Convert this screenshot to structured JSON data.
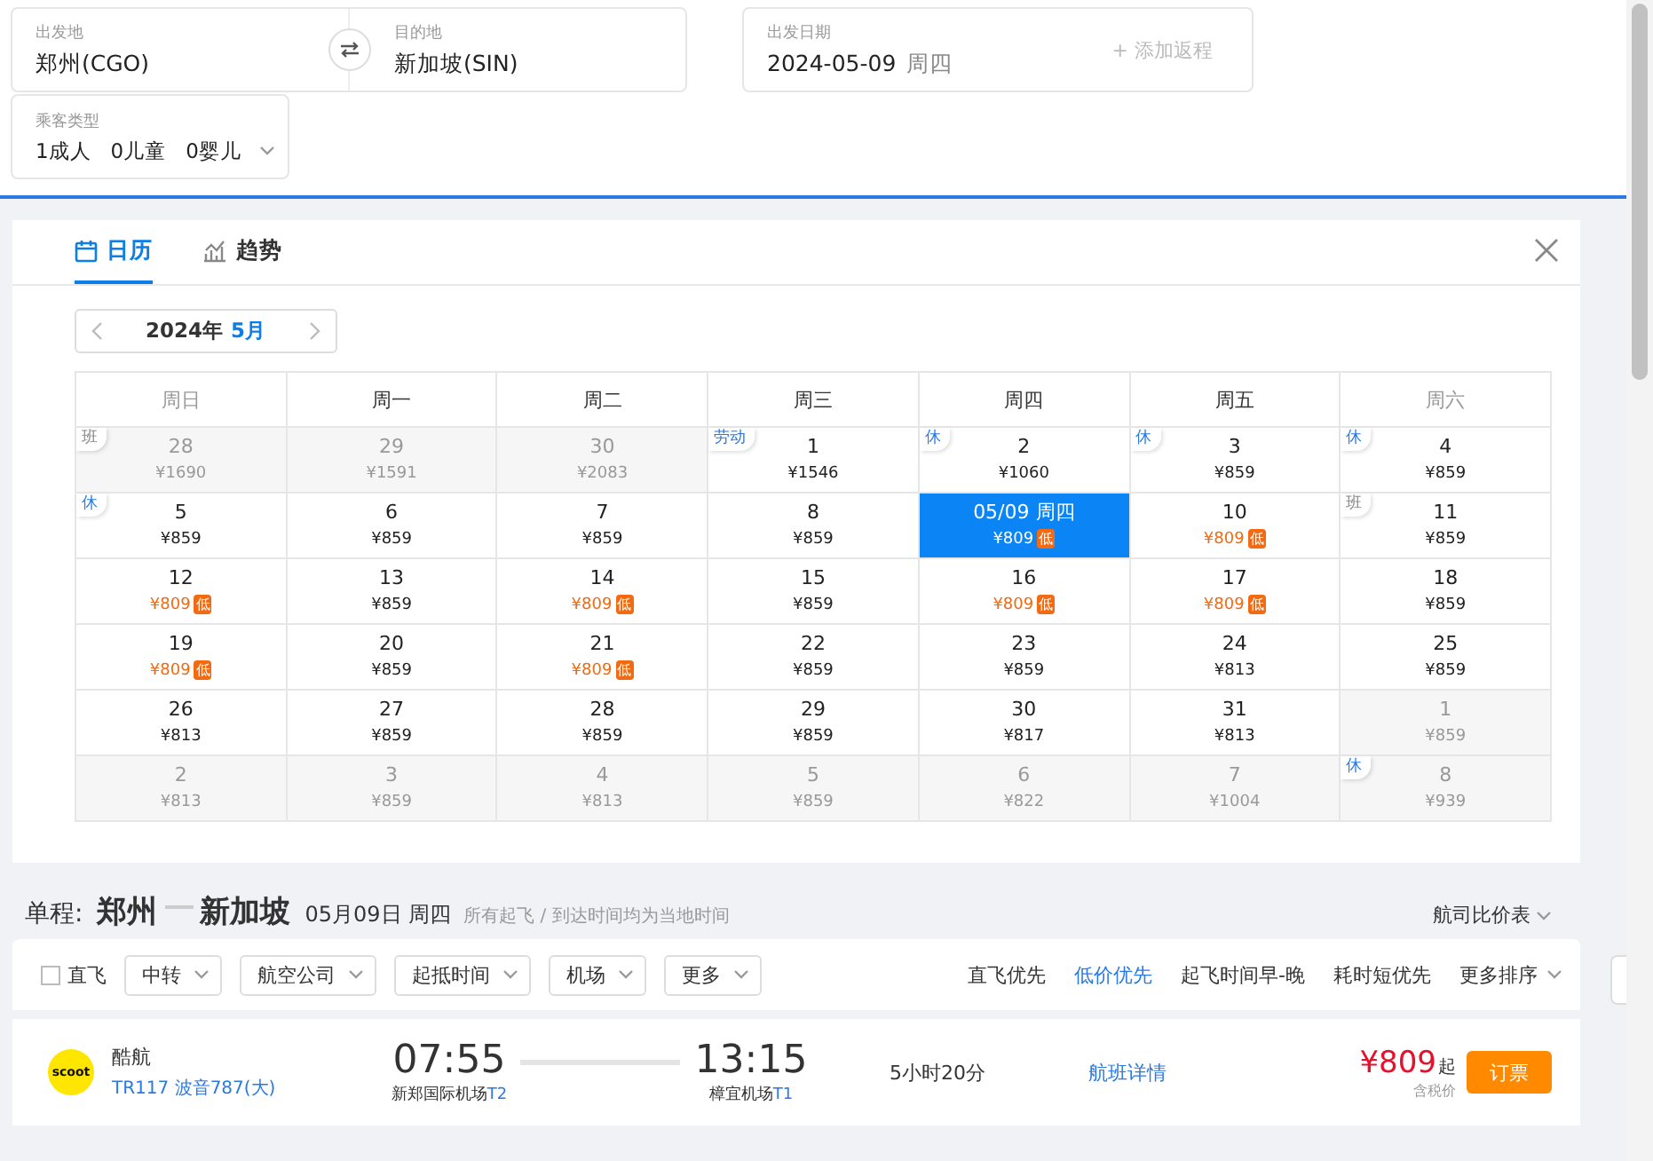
{
  "search": {
    "from": {
      "label": "出发地",
      "value": "郑州(CGO)"
    },
    "to": {
      "label": "目的地",
      "value": "新加坡(SIN)"
    },
    "date": {
      "label": "出发日期",
      "value": "2024-05-09",
      "weekday": "周四"
    },
    "add_return": "+ 添加返程",
    "passengers": {
      "label": "乘客类型",
      "value": "1成人   0儿童   0婴儿"
    }
  },
  "calendar": {
    "tabs": [
      {
        "label": "日历",
        "kind": "calendar",
        "selected": true
      },
      {
        "label": "趋势",
        "kind": "trend",
        "selected": false
      }
    ],
    "year": "2024年",
    "month": "5月",
    "weekdays": [
      {
        "label": "周日",
        "weekend": true
      },
      {
        "label": "周一",
        "weekend": false
      },
      {
        "label": "周二",
        "weekend": false
      },
      {
        "label": "周三",
        "weekend": false
      },
      {
        "label": "周四",
        "weekend": false
      },
      {
        "label": "周五",
        "weekend": false
      },
      {
        "label": "周六",
        "weekend": true
      }
    ],
    "weeks": [
      [
        {
          "day": "28",
          "price": "¥1690",
          "low": false,
          "muted": true,
          "selected": false,
          "tag": {
            "text": "班",
            "kind": "workday"
          }
        },
        {
          "day": "29",
          "price": "¥1591",
          "low": false,
          "muted": true,
          "selected": false
        },
        {
          "day": "30",
          "price": "¥2083",
          "low": false,
          "muted": true,
          "selected": false
        },
        {
          "day": "1",
          "price": "¥1546",
          "low": false,
          "muted": false,
          "selected": false,
          "tag": {
            "text": "劳动",
            "kind": "holiday"
          }
        },
        {
          "day": "2",
          "price": "¥1060",
          "low": false,
          "muted": false,
          "selected": false,
          "tag": {
            "text": "休",
            "kind": "holiday"
          }
        },
        {
          "day": "3",
          "price": "¥859",
          "low": false,
          "muted": false,
          "selected": false,
          "tag": {
            "text": "休",
            "kind": "holiday"
          }
        },
        {
          "day": "4",
          "price": "¥859",
          "low": false,
          "muted": false,
          "selected": false,
          "tag": {
            "text": "休",
            "kind": "holiday"
          }
        }
      ],
      [
        {
          "day": "5",
          "price": "¥859",
          "low": false,
          "muted": false,
          "selected": false,
          "tag": {
            "text": "休",
            "kind": "holiday"
          }
        },
        {
          "day": "6",
          "price": "¥859",
          "low": false,
          "muted": false,
          "selected": false
        },
        {
          "day": "7",
          "price": "¥859",
          "low": false,
          "muted": false,
          "selected": false
        },
        {
          "day": "8",
          "price": "¥859",
          "low": false,
          "muted": false,
          "selected": false
        },
        {
          "day": "05/09 周四",
          "price": "¥809",
          "low": true,
          "badge": "低",
          "muted": false,
          "selected": true
        },
        {
          "day": "10",
          "price": "¥809",
          "low": true,
          "badge": "低",
          "muted": false,
          "selected": false
        },
        {
          "day": "11",
          "price": "¥859",
          "low": false,
          "muted": false,
          "selected": false,
          "tag": {
            "text": "班",
            "kind": "workday"
          }
        }
      ],
      [
        {
          "day": "12",
          "price": "¥809",
          "low": true,
          "badge": "低",
          "muted": false,
          "selected": false
        },
        {
          "day": "13",
          "price": "¥859",
          "low": false,
          "muted": false,
          "selected": false
        },
        {
          "day": "14",
          "price": "¥809",
          "low": true,
          "badge": "低",
          "muted": false,
          "selected": false
        },
        {
          "day": "15",
          "price": "¥859",
          "low": false,
          "muted": false,
          "selected": false
        },
        {
          "day": "16",
          "price": "¥809",
          "low": true,
          "badge": "低",
          "muted": false,
          "selected": false
        },
        {
          "day": "17",
          "price": "¥809",
          "low": true,
          "badge": "低",
          "muted": false,
          "selected": false
        },
        {
          "day": "18",
          "price": "¥859",
          "low": false,
          "muted": false,
          "selected": false
        }
      ],
      [
        {
          "day": "19",
          "price": "¥809",
          "low": true,
          "badge": "低",
          "muted": false,
          "selected": false
        },
        {
          "day": "20",
          "price": "¥859",
          "low": false,
          "muted": false,
          "selected": false
        },
        {
          "day": "21",
          "price": "¥809",
          "low": true,
          "badge": "低",
          "muted": false,
          "selected": false
        },
        {
          "day": "22",
          "price": "¥859",
          "low": false,
          "muted": false,
          "selected": false
        },
        {
          "day": "23",
          "price": "¥859",
          "low": false,
          "muted": false,
          "selected": false
        },
        {
          "day": "24",
          "price": "¥813",
          "low": false,
          "muted": false,
          "selected": false
        },
        {
          "day": "25",
          "price": "¥859",
          "low": false,
          "muted": false,
          "selected": false
        }
      ],
      [
        {
          "day": "26",
          "price": "¥813",
          "low": false,
          "muted": false,
          "selected": false
        },
        {
          "day": "27",
          "price": "¥859",
          "low": false,
          "muted": false,
          "selected": false
        },
        {
          "day": "28",
          "price": "¥859",
          "low": false,
          "muted": false,
          "selected": false
        },
        {
          "day": "29",
          "price": "¥859",
          "low": false,
          "muted": false,
          "selected": false
        },
        {
          "day": "30",
          "price": "¥817",
          "low": false,
          "muted": false,
          "selected": false
        },
        {
          "day": "31",
          "price": "¥813",
          "low": false,
          "muted": false,
          "selected": false
        },
        {
          "day": "1",
          "price": "¥859",
          "low": false,
          "muted": true,
          "selected": false
        }
      ],
      [
        {
          "day": "2",
          "price": "¥813",
          "low": false,
          "muted": true,
          "selected": false
        },
        {
          "day": "3",
          "price": "¥859",
          "low": false,
          "muted": true,
          "selected": false
        },
        {
          "day": "4",
          "price": "¥813",
          "low": false,
          "muted": true,
          "selected": false
        },
        {
          "day": "5",
          "price": "¥859",
          "low": false,
          "muted": true,
          "selected": false
        },
        {
          "day": "6",
          "price": "¥822",
          "low": false,
          "muted": true,
          "selected": false
        },
        {
          "day": "7",
          "price": "¥1004",
          "low": false,
          "muted": true,
          "selected": false
        },
        {
          "day": "8",
          "price": "¥939",
          "low": false,
          "muted": true,
          "selected": false,
          "tag": {
            "text": "休",
            "kind": "holiday"
          }
        }
      ]
    ]
  },
  "summary": {
    "prefix": "单程:",
    "from": "郑州",
    "to": "新加坡",
    "date": "05月09日 周四",
    "note": "所有起飞 / 到达时间均为当地时间",
    "compare": "航司比价表"
  },
  "filters": {
    "direct": {
      "label": "直飞",
      "checked": false
    },
    "dropdowns": [
      "中转",
      "航空公司",
      "起抵时间",
      "机场",
      "更多"
    ],
    "sorts": [
      {
        "label": "直飞优先",
        "selected": false
      },
      {
        "label": "低价优先",
        "selected": true
      },
      {
        "label": "起飞时间早-晚",
        "selected": false
      },
      {
        "label": "耗时短优先",
        "selected": false
      }
    ],
    "more_sort": "更多排序"
  },
  "flights": [
    {
      "airline": "酷航",
      "logo": "scoot",
      "flight": "TR117 波音787(大)",
      "dep_time": "07:55",
      "dep_airport": "新郑国际机场",
      "dep_terminal": "T2",
      "arr_time": "13:15",
      "arr_airport": "樟宜机场",
      "arr_terminal": "T1",
      "duration": "5小时20分",
      "details": "航班详情",
      "price": "¥809",
      "price_suffix": "起",
      "tax_note": "含税价",
      "book": "订票"
    }
  ]
}
